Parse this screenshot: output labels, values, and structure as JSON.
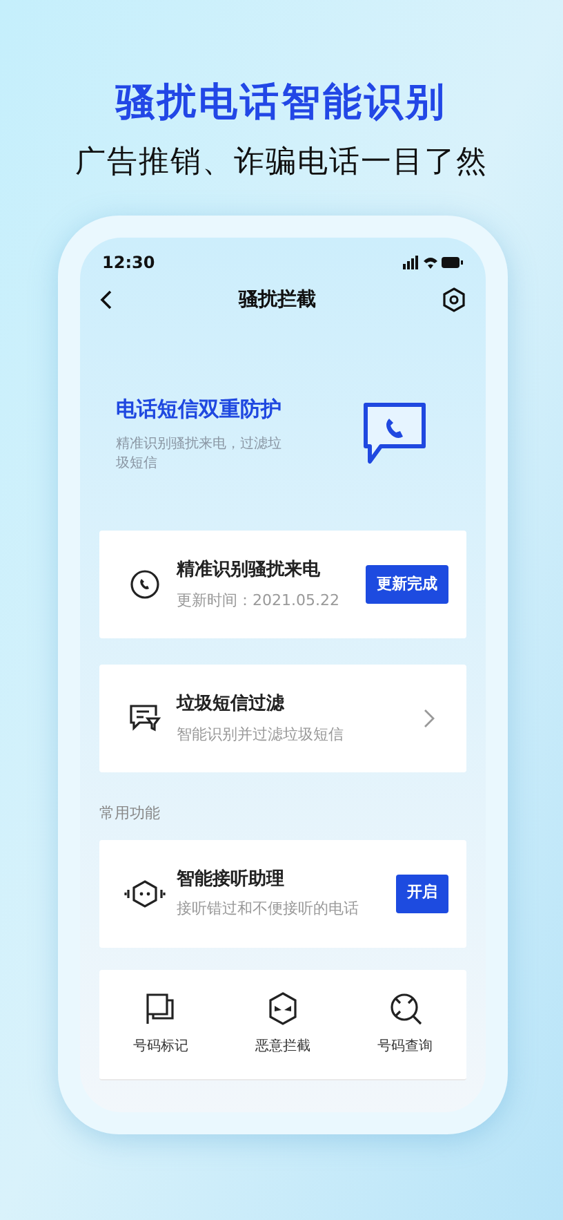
{
  "headline": "骚扰电话智能识别",
  "subtitle": "广告推销、诈骗电话一目了然",
  "status_bar": {
    "time": "12:30"
  },
  "nav": {
    "title": "骚扰拦截"
  },
  "hero": {
    "title": "电话短信双重防护",
    "description": "精准识别骚扰来电，过滤垃圾短信"
  },
  "cards": [
    {
      "kind": "button",
      "title": "精准识别骚扰来电",
      "subtitle": "更新时间：2021.05.22",
      "button": "更新完成"
    },
    {
      "kind": "link",
      "title": "垃圾短信过滤",
      "subtitle": "智能识别并过滤垃圾短信"
    }
  ],
  "section_label": "常用功能",
  "assistant_card": {
    "kind": "button",
    "title": "智能接听助理",
    "subtitle": "接听错过和不便接听的电话",
    "button": "开启"
  },
  "quick_actions": [
    {
      "label": "号码标记"
    },
    {
      "label": "恶意拦截"
    },
    {
      "label": "号码查询"
    }
  ]
}
